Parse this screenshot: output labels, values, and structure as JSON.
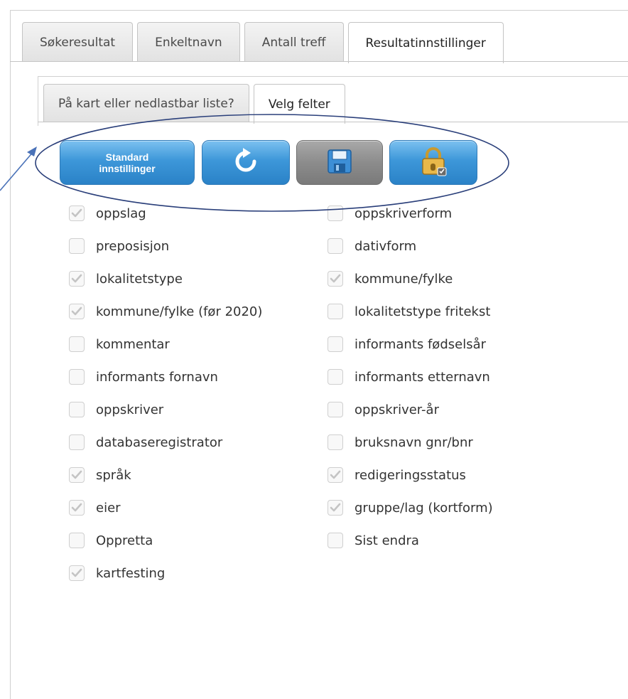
{
  "outer_tabs": [
    {
      "label": "Søkeresultat",
      "active": false
    },
    {
      "label": "Enkeltnavn",
      "active": false
    },
    {
      "label": "Antall treff",
      "active": false
    },
    {
      "label": "Resultatinnstillinger",
      "active": true
    }
  ],
  "inner_tabs": [
    {
      "label": "På kart eller nedlastbar liste?",
      "active": false
    },
    {
      "label": "Velg felter",
      "active": true
    }
  ],
  "toolbar": {
    "standard_line1": "Standard",
    "standard_line2": "innstillinger",
    "refresh_icon": "refresh-icon",
    "save_icon": "floppy-disk-icon",
    "lock_icon": "lock-icon"
  },
  "fields_left": [
    {
      "label": "oppslag",
      "checked": true
    },
    {
      "label": "preposisjon",
      "checked": false
    },
    {
      "label": "lokalitetstype",
      "checked": true
    },
    {
      "label": "kommune/fylke (før 2020)",
      "checked": true
    },
    {
      "label": "kommentar",
      "checked": false
    },
    {
      "label": "informants fornavn",
      "checked": false
    },
    {
      "label": "oppskriver",
      "checked": false
    },
    {
      "label": "databaseregistrator",
      "checked": false
    },
    {
      "label": "språk",
      "checked": true
    },
    {
      "label": "eier",
      "checked": true
    },
    {
      "label": "Oppretta",
      "checked": false
    },
    {
      "label": "kartfesting",
      "checked": true
    }
  ],
  "fields_right": [
    {
      "label": "oppskriverform",
      "checked": false
    },
    {
      "label": "dativform",
      "checked": false
    },
    {
      "label": "kommune/fylke",
      "checked": true
    },
    {
      "label": "lokalitetstype fritekst",
      "checked": false
    },
    {
      "label": "informants fødselsår",
      "checked": false
    },
    {
      "label": "informants etternavn",
      "checked": false
    },
    {
      "label": "oppskriver-år",
      "checked": false
    },
    {
      "label": "bruksnavn gnr/bnr",
      "checked": false
    },
    {
      "label": "redigeringsstatus",
      "checked": true
    },
    {
      "label": "gruppe/lag (kortform)",
      "checked": true
    },
    {
      "label": "Sist endra",
      "checked": false
    }
  ],
  "colors": {
    "annotation": "#2a3f7a",
    "button_blue": "#3d97d9",
    "button_gray": "#8c8c8c",
    "check_mark": "#c4c4c4"
  }
}
